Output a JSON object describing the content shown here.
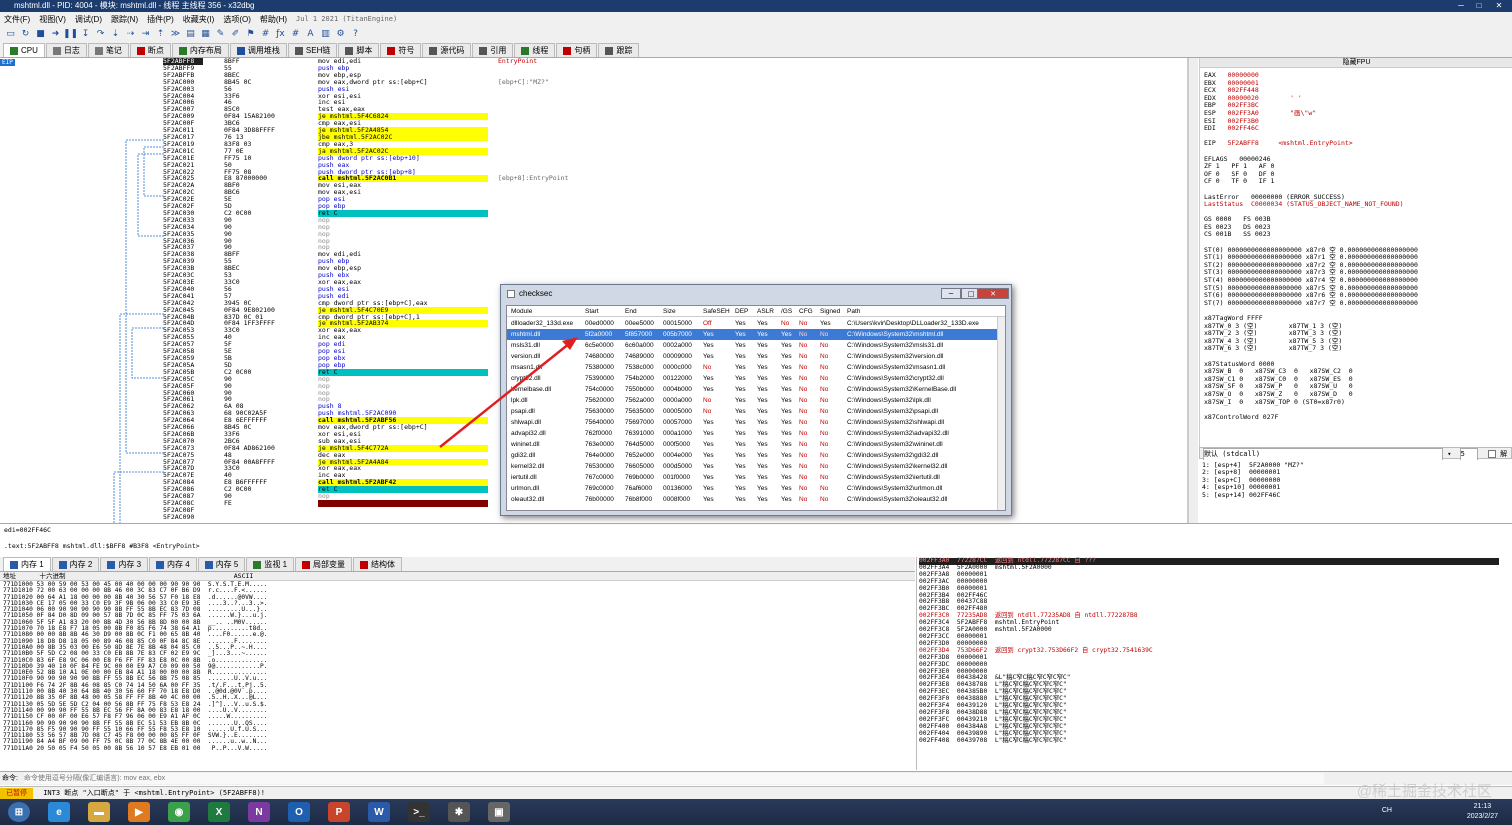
{
  "window": {
    "title": "mshtml.dll - PID: 4004 - 模块: mshtml.dll - 线程 主线程 356 - x32dbg",
    "minimize": "─",
    "maximize": "□",
    "close": "✕"
  },
  "menu": [
    "文件(F)",
    "视图(V)",
    "调试(D)",
    "跟踪(N)",
    "插件(P)",
    "收藏夹(I)",
    "选项(O)",
    "帮助(H)",
    "Jul 1 2021 (TitanEngine)"
  ],
  "tabs": [
    {
      "label": "CPU",
      "color": "#2a7a2a"
    },
    {
      "label": "日志",
      "color": "#777"
    },
    {
      "label": "笔记",
      "color": "#777"
    },
    {
      "label": "断点",
      "color": "#c00000"
    },
    {
      "label": "内存布局",
      "color": "#2a7a2a"
    },
    {
      "label": "调用堆栈",
      "color": "#1f4f9a"
    },
    {
      "label": "SEH链",
      "color": "#555"
    },
    {
      "label": "脚本",
      "color": "#555"
    },
    {
      "label": "符号",
      "color": "#c00000"
    },
    {
      "label": "源代码",
      "color": "#555"
    },
    {
      "label": "引用",
      "color": "#555"
    },
    {
      "label": "线程",
      "color": "#2a7a2a"
    },
    {
      "label": "句柄",
      "color": "#c00000"
    },
    {
      "label": "跟踪",
      "color": "#555"
    }
  ],
  "cpu": {
    "eip_label": "EIP",
    "addresses": [
      "5F2ABFF8",
      "5F2ABFF9",
      "5F2ABFFB",
      "5F2AC000",
      "5F2AC003",
      "5F2AC004",
      "5F2AC006",
      "5F2AC007",
      "5F2AC009",
      "5F2AC00F",
      "5F2AC011",
      "5F2AC017",
      "5F2AC019",
      "5F2AC01C",
      "5F2AC01E",
      "5F2AC021",
      "5F2AC022",
      "5F2AC025",
      "5F2AC02A",
      "5F2AC02C",
      "5F2AC02E",
      "5F2AC02F",
      "5F2AC030",
      "5F2AC033",
      "5F2AC034",
      "5F2AC035",
      "5F2AC036",
      "5F2AC037",
      "5F2AC038",
      "5F2AC039",
      "5F2AC03B",
      "5F2AC03C",
      "5F2AC03E",
      "5F2AC040",
      "5F2AC041",
      "5F2AC042",
      "5F2AC045",
      "5F2AC04B",
      "5F2AC04D",
      "5F2AC053",
      "5F2AC055",
      "5F2AC057",
      "5F2AC058",
      "5F2AC059",
      "5F2AC05A",
      "5F2AC05B",
      "5F2AC05C",
      "5F2AC05F",
      "5F2AC060",
      "5F2AC061",
      "5F2AC062",
      "5F2AC063",
      "5F2AC064",
      "5F2AC066",
      "5F2AC06B",
      "5F2AC070",
      "5F2AC073",
      "5F2AC075",
      "5F2AC077",
      "5F2AC07D",
      "5F2AC07E",
      "5F2AC084",
      "5F2AC086",
      "5F2AC087",
      "5F2AC08C",
      "5F2AC08F",
      "5F2AC090"
    ],
    "bytes": [
      "8BFF",
      "55",
      "8BEC",
      "8B45 0C",
      "56",
      "33F6",
      "46",
      "85C0",
      "0F84 15A82100",
      "3BC6",
      "0F84 3D88FFFF",
      "76 13",
      "83F8 03",
      "77 0E",
      "FF75 10",
      "50",
      "FF75 08",
      "E8 87000000",
      "8BF0",
      "8BC6",
      "5E",
      "5D",
      "C2 0C00",
      "90",
      "90",
      "90",
      "90",
      "90",
      "8BFF",
      "55",
      "8BEC",
      "53",
      "33C0",
      "56",
      "57",
      "3945 0C",
      "0F84 9E802100",
      "837D 0C 01",
      "0F84 1FF3FFFF",
      "33C0",
      "40",
      "5F",
      "5E",
      "5B",
      "5D",
      "C2 0C00",
      "90",
      "90",
      "90",
      "90",
      "6A 08",
      "68 90C02A5F",
      "E8 6EFFFFFF",
      "8B45 0C",
      "33F6",
      "2BC6",
      "0F84 AD862100",
      "48",
      "0F84 00A8FFFF",
      "33C0",
      "40",
      "E8 B6FFFFFF",
      "C2 0C00",
      "90",
      "FE"
    ],
    "disasm": [
      "mov edi,edi",
      "push ebp",
      "mov ebp,esp",
      "mov eax,dword ptr ss:[ebp+C]",
      "push esi",
      "xor esi,esi",
      "inc esi",
      "test eax,eax",
      "je mshtml.5F4C6824",
      "cmp eax,esi",
      "je mshtml.5F2A4854",
      "jbe mshtml.5F2AC02C",
      "cmp eax,3",
      "ja mshtml.5F2AC02C",
      "push dword ptr ss:[ebp+10]",
      "push eax",
      "push dword ptr ss:[ebp+8]",
      "call mshtml.5F2AC0B1",
      "mov esi,eax",
      "mov eax,esi",
      "pop esi",
      "pop ebp",
      "ret C",
      "nop",
      "nop",
      "nop",
      "nop",
      "nop",
      "mov edi,edi",
      "push ebp",
      "mov ebp,esp",
      "push ebx",
      "xor eax,eax",
      "push esi",
      "push edi",
      "cmp dword ptr ss:[ebp+C],eax",
      "je mshtml.5F4C70E9",
      "cmp dword ptr ss:[ebp+C],1",
      "je mshtml.5F2AB374",
      "xor eax,eax",
      "inc eax",
      "pop edi",
      "pop esi",
      "pop ebx",
      "pop ebp",
      "ret C",
      "nop",
      "nop",
      "nop",
      "nop",
      "push 8",
      "push mshtml.5F2AC090",
      "call mshtml.5F2ABF56",
      "mov eax,dword ptr ss:[ebp+C]",
      "xor esi,esi",
      "sub eax,esi",
      "je mshtml.5F4C772A",
      "dec eax",
      "je mshtml.5F2A4A84",
      "xor eax,eax",
      "inc eax",
      "call mshtml.5F2ABF42",
      "ret C",
      "nop",
      "???"
    ],
    "comments": [
      "EntryPoint",
      "",
      "",
      "[ebp+C]:\"MZ?\"",
      "",
      "",
      "",
      "",
      "",
      "",
      "",
      "",
      "",
      "",
      "",
      "",
      "",
      "[ebp+8]:EntryPoint"
    ],
    "info_line1": "edi=002FF46C",
    "info_line2": ".text:5F2ABFF8 mshtml.dll:$BFF8 #B3F8 <EntryPoint>"
  },
  "registers": {
    "header": "隐藏FPU",
    "lines": [
      "EAX   00000000",
      "EBX   00000001",
      "ECX   002FF448",
      "EDX   00000020        ' '",
      "EBP   002FF3BC",
      "ESP   002FF3A0        \"画\\\"w\"",
      "ESI   002FF3B0",
      "EDI   002FF46C",
      "",
      "EIP   5F2ABFF8     <mshtml.EntryPoint>",
      "",
      "EFLAGS   00000246",
      "ZF 1   PF 1   AF 0",
      "OF 0   SF 0   DF 0",
      "CF 0   TF 0   IF 1",
      "",
      "LastError   00000000 (ERROR_SUCCESS)",
      "LastStatus  C0000034 (STATUS_OBJECT_NAME_NOT_FOUND)",
      "",
      "GS 0000   FS 003B",
      "ES 0023   DS 0023",
      "CS 001B   SS 0023",
      "",
      "ST(0) 0000000000000000000 x87r0 空 0.000000000000000000",
      "ST(1) 0000000000000000000 x87r1 空 0.000000000000000000",
      "ST(2) 0000000000000000000 x87r2 空 0.000000000000000000",
      "ST(3) 0000000000000000000 x87r3 空 0.000000000000000000",
      "ST(4) 0000000000000000000 x87r4 空 0.000000000000000000",
      "ST(5) 0000000000000000000 x87r5 空 0.000000000000000000",
      "ST(6) 0000000000000000000 x87r6 空 0.000000000000000000",
      "ST(7) 0000000000000000000 x87r7 空 0.000000000000000000",
      "",
      "x87TagWord FFFF",
      "x87TW_0 3 (空)        x87TW_1 3 (空)",
      "x87TW_2 3 (空)        x87TW_3 3 (空)",
      "x87TW_4 3 (空)        x87TW_5 3 (空)",
      "x87TW_6 3 (空)        x87TW_7 3 (空)",
      "",
      "x87StatusWord 0000",
      "x87SW_B  0   x87SW_C3  0   x87SW_C2  0",
      "x87SW_C1 0   x87SW_C0  0   x87SW_ES  0",
      "x87SW_SF 0   x87SW_P   0   x87SW_U   0",
      "x87SW_O  0   x87SW_Z   0   x87SW_D   0",
      "x87SW_I  0   x87SW_TOP 0 (ST0=x87r0)",
      "",
      "x87ControlWord 027F"
    ]
  },
  "callconv": {
    "label": "默认 (stdcall)",
    "count": "5",
    "unlock": "解锁"
  },
  "stack_args": [
    "1: [esp+4]  5F2A0000 \"MZ?\"",
    "2: [esp+8]  00000001",
    "3: [esp+C]  00000000",
    "4: [esp+10] 00000001",
    "5: [esp+14] 002FF46C"
  ],
  "dump_tabs": [
    "内存 1",
    "内存 2",
    "内存 3",
    "内存 4",
    "内存 5",
    "监视 1",
    "局部变量",
    "结构体"
  ],
  "dump": {
    "header": "地址      十六进制                                           ASCII",
    "rows": [
      "771D1000 53 00 59 00 53 00 45 00 40 00 00 00 90 90 90  S.Y.S.T.E.M.....",
      "771D1010 72 00 63 00 00 00 8B 46 00 3C 83 C7 0F B6 D9  r.c....F.<......",
      "771D1020 00 64 A1 18 00 00 00 8B 40 30 56 57 F0 18 E8  .d......@0VW....",
      "771D1030 CE 17 05 00 33 C0 E9 3F 9B 06 00 33 C0 E9 3E  ....3..?...3..>.",
      "771D1040 06 00 90 90 90 90 90 8B FF 55 8B EC 83 7D 08  .........U...}..",
      "771D1050 0F 84 D0 8D 09 00 57 8B 7D 0C 85 FF 75 03 6A  ......W.}...u.j.",
      "771D1060 5F 5F A1 83 20 00 8B 4D 30 56 8B 8D 00 00 8B  __.. ..M0V......",
      "771D1070 70 18 E8 F7 18 05 00 8B F0 85 F6 74 38 64 A1  p..........t8d..",
      "771D1080 00 00 8B 8B 46 30 D9 00 8B 0C F1 00 65 8B 40  ....F0......e.@.",
      "771D1090 18 D8 D8 18 05 00 89 46 08 85 C0 0F 84 8C 8E  .......F........",
      "771D10A0 00 8B 35 03 00 E6 50 8D 8E 7E 8B 48 04 85 C0  ..5...P..~.H....",
      "771D10B0 5F 5D C2 08 00 33 C0 EB 8B 7E 83 CF 02 E9 9C  _]...3...~......",
      "771D10C0 83 6F E8 9C 06 00 E8 F6 FF FF 83 E8 0C 00 8B  .o..............",
      "771D10D0 39 40 10 0F 84 FE 9C 00 00 E9 A7 C0 09 00 50  9@............P.",
      "771D10E0 52 8B 10 A1 0E 00 00 EB 84 A1 18 00 00 00 8B  R...............",
      "771D10F0 90 90 90 90 90 8B FF 55 8B EC 56 8B 75 08 85  .......U..V.u...",
      "771D1100 F6 74 2F 8B 46 08 85 C0 74 14 50 6A 00 FF 35  .t/.F...t.Pj..5.",
      "771D1110 00 8B 40 30 64 8B 40 30 56 60 FF 70 18 E8 D0  ..@0d.@0V`.p....",
      "771D1120 8B 35 0F 8B 48 00 05 58 FF FF 8B 40 4C 00 00  .5..H..X...@L...",
      "771D1130 05 5D 5E 5D C2 04 00 56 8B FF 75 F8 53 E8 24  .]^]...V..u.S.$.",
      "771D1140 00 90 90 FF 55 8B EC 56 FF 8A 00 83 E8 18 00  ....U..V........",
      "771D1150 CF 00 0F 00 E6 57 F8 F7 96 06 00 E9 A1 AF 0C  .....W..........",
      "771D1160 90 90 90 90 90 8B FF 55 8B EC 51 53 EB 8B 0C  .......U..QS....",
      "771D1170 85 F5 90 90 90 FF 55 10 66 FF 55 F8 53 E8 10  ......U.f.U.S...",
      "771D1180 53 56 57 8B 7D 08 C7 45 F8 00 00 00 85 FF 0F  SVW.}..E........",
      "771D1190 84 A4 BF 09 00 FF 75 0C 8B 77 0C 8B 4E 00 00  ......u..w..N...",
      "771D11A0 20 50 05 F4 50 05 00 8B 56 10 57 E8 EB 01 00   P..P...V.W....."
    ]
  },
  "stack": {
    "top_label": "002FF3A0",
    "rows": [
      "002FF3A0  772287CC  返回到 ntdll.772287CC 自 ???",
      "002FF3A4  5F2A0000  mshtml.5F2A0000",
      "002FF3A8  00000001",
      "002FF3AC  00000000",
      "002FF3B0  00000001",
      "002FF3B4  002FF46C",
      "002FF3B8  00437C88",
      "002FF3BC  002FF480",
      "002FF3C0  77235AD8  返回到 ntdll.77235AD8 自 ntdll.772287B8",
      "002FF3C4  5F2ABFF8  mshtml.EntryPoint",
      "002FF3C8  5F2A0000  mshtml.5F2A0000",
      "002FF3CC  00000001",
      "002FF3D0  00000000",
      "002FF3D4  753D66F2  返回到 crypt32.753D66F2 自 crypt32.7541639C",
      "002FF3D8  00000001",
      "002FF3DC  00000000",
      "002FF3E0  00000000",
      "002FF3E4  00438428  &L\"稿C窄C稿C窄C窄C窄C\"",
      "002FF3E8  00438788  L\"稿C窄C稿C窄C窄C窄C\"",
      "002FF3EC  004385B0  L\"稿C窄C稿C窄C窄C窄C\"",
      "002FF3F0  00438880  L\"稿C窄C稿C窄C窄C窄C\"",
      "002FF3F4  00439120  L\"稿C窄C稿C窄C窄C窄C\"",
      "002FF3F8  00438D88  L\"稿C窄C稿C窄C窄C窄C\"",
      "002FF3FC  00439210  L\"稿C窄C稿C窄C窄C窄C\"",
      "002FF400  004384A8  L\"稿C窄C稿C窄C窄C窄C\"",
      "002FF404  00439890  L\"稿C窄C稿C窄C窄C窄C\"",
      "002FF408  00439708  L\"稿C窄C稿C窄C窄C窄C\""
    ]
  },
  "cmd": {
    "label": "命令:",
    "placeholder": "命令使用逗号分隔(像汇编语言): mov eax, ebx"
  },
  "status": {
    "paused": "已暂停",
    "message": "INT3 断点 \"入口断点\" 于 <mshtml.EntryPoint> (5F2ABFF8)!"
  },
  "checksec": {
    "title": "checksec",
    "headers": [
      "Module",
      "Start",
      "End",
      "Size",
      "SafeSEH",
      "DEP",
      "ASLR",
      "/GS",
      "CFG",
      "Signed",
      "Path"
    ],
    "rows": [
      [
        "dllloader32_133d.exe",
        "00ed0000",
        "00ee5000",
        "00015000",
        "Off",
        "Yes",
        "Yes",
        "No",
        "No",
        "Yes",
        "C:\\Users\\kvir\\Desktop\\DLLoader32_133D.exe"
      ],
      [
        "mshtml.dll",
        "5f2a0000",
        "5f857000",
        "005b7000",
        "Yes",
        "Yes",
        "Yes",
        "Yes",
        "No",
        "No",
        "C:\\Windows\\System32\\mshtml.dll"
      ],
      [
        "msls31.dll",
        "6c5e0000",
        "6c60a000",
        "0002a000",
        "Yes",
        "Yes",
        "Yes",
        "Yes",
        "No",
        "No",
        "C:\\Windows\\System32\\msls31.dll"
      ],
      [
        "version.dll",
        "74680000",
        "74689000",
        "00009000",
        "Yes",
        "Yes",
        "Yes",
        "Yes",
        "No",
        "No",
        "C:\\Windows\\System32\\version.dll"
      ],
      [
        "msasn1.dll",
        "75380000",
        "7538c000",
        "0000c000",
        "No",
        "Yes",
        "Yes",
        "Yes",
        "No",
        "No",
        "C:\\Windows\\System32\\msasn1.dll"
      ],
      [
        "crypt32.dll",
        "75390000",
        "754b2000",
        "00122000",
        "Yes",
        "Yes",
        "Yes",
        "Yes",
        "No",
        "No",
        "C:\\Windows\\System32\\crypt32.dll"
      ],
      [
        "kernelbase.dll",
        "754c0000",
        "7550b000",
        "0004b000",
        "Yes",
        "Yes",
        "Yes",
        "Yes",
        "No",
        "No",
        "C:\\Windows\\System32\\KernelBase.dll"
      ],
      [
        "lpk.dll",
        "75620000",
        "7562a000",
        "0000a000",
        "No",
        "Yes",
        "Yes",
        "Yes",
        "No",
        "No",
        "C:\\Windows\\System32\\lpk.dll"
      ],
      [
        "psapi.dll",
        "75630000",
        "75635000",
        "00005000",
        "No",
        "Yes",
        "Yes",
        "Yes",
        "No",
        "No",
        "C:\\Windows\\System32\\psapi.dll"
      ],
      [
        "shlwapi.dll",
        "75640000",
        "75697000",
        "00057000",
        "Yes",
        "Yes",
        "Yes",
        "Yes",
        "No",
        "No",
        "C:\\Windows\\System32\\shlwapi.dll"
      ],
      [
        "advapi32.dll",
        "762f0000",
        "76391000",
        "000a1000",
        "Yes",
        "Yes",
        "Yes",
        "Yes",
        "No",
        "No",
        "C:\\Windows\\System32\\advapi32.dll"
      ],
      [
        "wininet.dll",
        "763e0000",
        "764d5000",
        "000f5000",
        "Yes",
        "Yes",
        "Yes",
        "Yes",
        "No",
        "No",
        "C:\\Windows\\System32\\wininet.dll"
      ],
      [
        "gdi32.dll",
        "764e0000",
        "7652e000",
        "0004e000",
        "Yes",
        "Yes",
        "Yes",
        "Yes",
        "No",
        "No",
        "C:\\Windows\\System32\\gdi32.dll"
      ],
      [
        "kernel32.dll",
        "76530000",
        "76605000",
        "000d5000",
        "Yes",
        "Yes",
        "Yes",
        "Yes",
        "No",
        "No",
        "C:\\Windows\\System32\\kernel32.dll"
      ],
      [
        "iertutil.dll",
        "767c0000",
        "769b0000",
        "001f0000",
        "Yes",
        "Yes",
        "Yes",
        "Yes",
        "No",
        "No",
        "C:\\Windows\\System32\\iertutil.dll"
      ],
      [
        "urlmon.dll",
        "769c0000",
        "76af6000",
        "00136000",
        "Yes",
        "Yes",
        "Yes",
        "Yes",
        "No",
        "No",
        "C:\\Windows\\System32\\urlmon.dll"
      ],
      [
        "oleaut32.dll",
        "76b00000",
        "76b8f000",
        "0008f000",
        "Yes",
        "Yes",
        "Yes",
        "Yes",
        "No",
        "No",
        "C:\\Windows\\System32\\oleaut32.dll"
      ]
    ]
  },
  "taskbar": {
    "apps": [
      {
        "icon": "windows-start-icon",
        "glyph": "⊞",
        "color": "#3a6fb0"
      },
      {
        "icon": "ie-icon",
        "glyph": "e",
        "color": "#2a8ad8"
      },
      {
        "icon": "folder-icon",
        "glyph": "▬",
        "color": "#d8a840"
      },
      {
        "icon": "media-icon",
        "glyph": "▶",
        "color": "#e07a20"
      },
      {
        "icon": "chrome-icon",
        "glyph": "◉",
        "color": "#3aa04a"
      },
      {
        "icon": "excel-icon",
        "glyph": "X",
        "color": "#1f7a40"
      },
      {
        "icon": "onenote-icon",
        "glyph": "N",
        "color": "#7a3aa0"
      },
      {
        "icon": "outlook-icon",
        "glyph": "O",
        "color": "#1f5fb0"
      },
      {
        "icon": "powerpoint-icon",
        "glyph": "P",
        "color": "#c8442a"
      },
      {
        "icon": "word-icon",
        "glyph": "W",
        "color": "#2a5aa8"
      },
      {
        "icon": "terminal-icon",
        "glyph": ">_",
        "color": "#333"
      },
      {
        "icon": "x32dbg-icon",
        "glyph": "✱",
        "color": "#555"
      },
      {
        "icon": "window-icon",
        "glyph": "▣",
        "color": "#666"
      }
    ],
    "time": "21:13",
    "date": "2023/2/27",
    "tray": "CH"
  },
  "watermark": "@稀土掘金技术社区"
}
